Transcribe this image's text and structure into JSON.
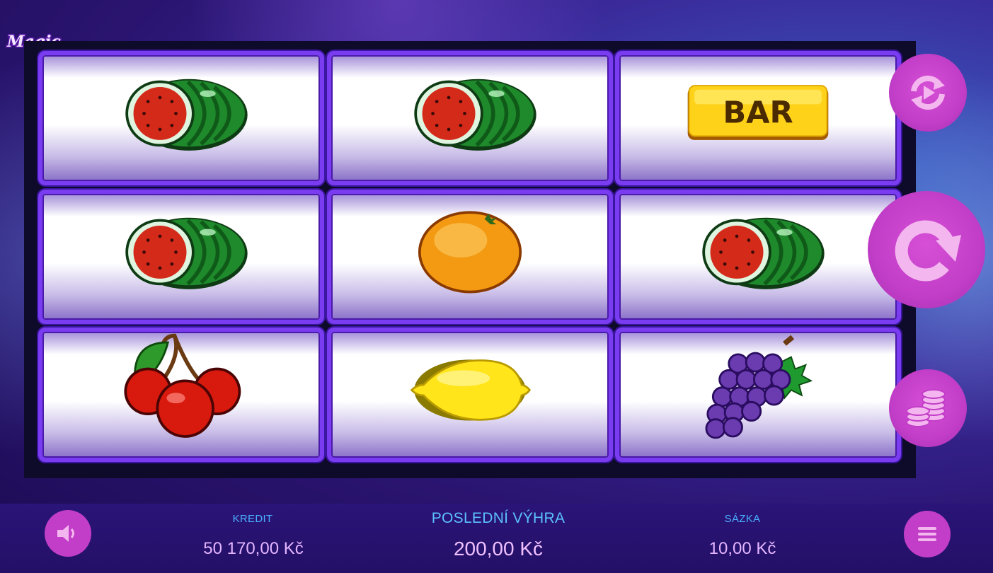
{
  "logo": {
    "text": "Magic Lady"
  },
  "reels": [
    [
      "watermelon",
      "watermelon",
      "bar"
    ],
    [
      "watermelon",
      "orange",
      "watermelon"
    ],
    [
      "cherry",
      "lemon",
      "grapes"
    ]
  ],
  "bar_symbol_text": "BAR",
  "buttons": {
    "autoplay": "autoplay-icon",
    "spin": "spin-icon",
    "bet": "coins-icon",
    "sound": "speaker-icon",
    "menu": "hamburger-menu-icon"
  },
  "stats": {
    "credit_label": "KREDIT",
    "credit_value": "50 170,00 Kč",
    "last_win_label": "POSLEDNÍ VÝHRA",
    "last_win_value": "200,00 Kč",
    "bet_label": "SÁZKA",
    "bet_value": "10,00 Kč"
  },
  "colors": {
    "accent_button": "#c23ec8",
    "label_blue": "#4ab0ff",
    "value_pink": "#e4b5ff",
    "reel_border": "#7a3cf0"
  }
}
